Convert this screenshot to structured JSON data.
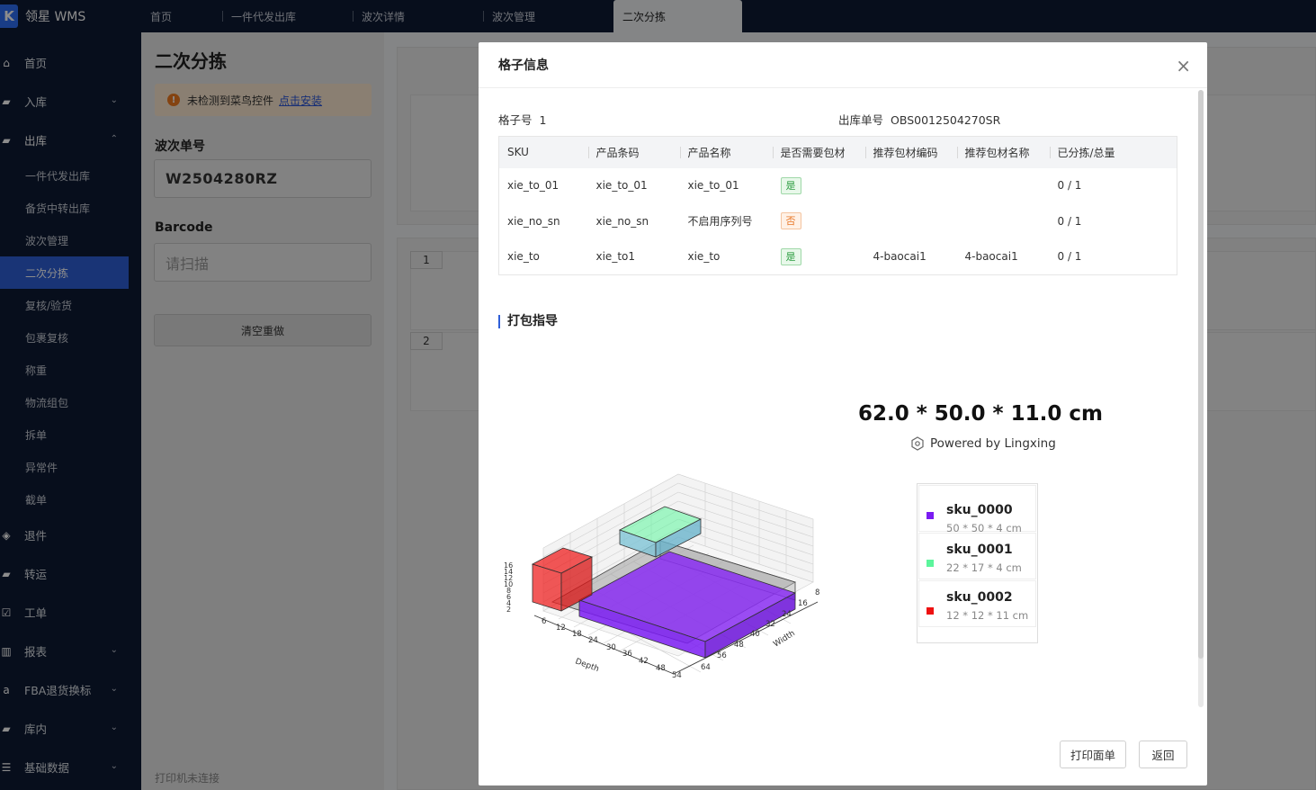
{
  "app": {
    "logo_letter": "K",
    "name": "领星 WMS"
  },
  "tabs": [
    {
      "label": "首页"
    },
    {
      "label": "一件代发出库"
    },
    {
      "label": "波次详情"
    },
    {
      "label": "波次管理"
    },
    {
      "label": "二次分拣",
      "active": true
    }
  ],
  "sidebar": {
    "items": [
      {
        "label": "首页",
        "icon": "home-icon"
      },
      {
        "label": "入库",
        "icon": "inbound-icon",
        "chevron": "⌄"
      },
      {
        "label": "出库",
        "icon": "outbound-icon",
        "chevron": "⌃"
      },
      {
        "label": "退件",
        "icon": "return-icon"
      },
      {
        "label": "转运",
        "icon": "transfer-icon"
      },
      {
        "label": "工单",
        "icon": "workorder-icon"
      },
      {
        "label": "报表",
        "icon": "report-icon",
        "chevron": "⌄"
      },
      {
        "label": "FBA退货换标",
        "icon": "fba-icon",
        "chevron": "⌄"
      },
      {
        "label": "库内",
        "icon": "warehouse-icon",
        "chevron": "⌄"
      },
      {
        "label": "基础数据",
        "icon": "data-icon",
        "chevron": "⌄"
      }
    ],
    "outbound_sub": [
      "一件代发出库",
      "备货中转出库",
      "波次管理",
      "二次分拣",
      "复核/验货",
      "包裹复核",
      "称重",
      "物流组包",
      "拆单",
      "异常件",
      "截单"
    ]
  },
  "left_panel": {
    "title": "二次分拣",
    "warning_text": "未检测到菜鸟控件",
    "warning_link": "点击安装",
    "wave_label": "波次单号",
    "wave_value": "W2504280RZ",
    "barcode_label": "Barcode",
    "barcode_placeholder": "请扫描",
    "reset_button": "清空重做",
    "printer_status": "打印机未连接"
  },
  "bg_cells": [
    "1",
    "2"
  ],
  "modal": {
    "title": "格子信息",
    "close": "×",
    "grid_label": "格子号",
    "grid_value": "1",
    "order_label": "出库单号",
    "order_value": "OBS0012504270SR",
    "table": {
      "headers": [
        "SKU",
        "产品条码",
        "产品名称",
        "是否需要包材",
        "推荐包材编码",
        "推荐包材名称",
        "已分拣/总量"
      ],
      "rows": [
        {
          "sku": "xie_to_01",
          "barcode": "xie_to_01",
          "name": "xie_to_01",
          "need": "是",
          "need_type": "yes",
          "code": "",
          "pname": "",
          "progress": "0 / 1"
        },
        {
          "sku": "xie_no_sn",
          "barcode": "xie_no_sn",
          "name": "不启用序列号",
          "need": "否",
          "need_type": "no",
          "code": "",
          "pname": "",
          "progress": "0 / 1"
        },
        {
          "sku": "xie_to",
          "barcode": "xie_to1",
          "name": "xie_to",
          "need": "是",
          "need_type": "yes",
          "code": "4-baocai1",
          "pname": "4-baocai1",
          "progress": "0 / 1"
        }
      ]
    },
    "section_title": "打包指导",
    "dimensions": "62.0 * 50.0 * 11.0 cm",
    "powered_by": "Powered by Lingxing",
    "legend": [
      {
        "name": "sku_0000",
        "dims": "50 * 50 * 4 cm",
        "color": "#7a1bf2"
      },
      {
        "name": "sku_0001",
        "dims": "22 * 17 * 4 cm",
        "color": "#5cf59c"
      },
      {
        "name": "sku_0002",
        "dims": "12 * 12 * 11 cm",
        "color": "#ee1111"
      }
    ],
    "plot": {
      "z_ticks": [
        "16",
        "14",
        "12",
        "10",
        "8",
        "6",
        "4",
        "2"
      ],
      "depth_ticks": [
        "6",
        "12",
        "18",
        "24",
        "30",
        "36",
        "42",
        "48",
        "54"
      ],
      "width_ticks": [
        "8",
        "16",
        "24",
        "32",
        "40",
        "48",
        "56",
        "64"
      ],
      "depth_label": "Depth",
      "width_label": "Width"
    },
    "buttons": {
      "print": "打印面单",
      "back": "返回"
    }
  }
}
